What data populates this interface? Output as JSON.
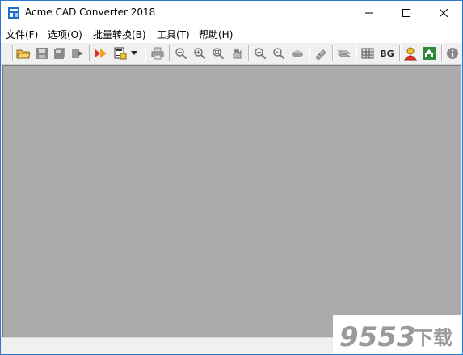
{
  "window": {
    "title": "Acme CAD Converter 2018",
    "controls": {
      "minimize": "minimize-icon",
      "maximize": "maximize-icon",
      "close": "close-icon"
    }
  },
  "menu": [
    {
      "label": "文件(F)"
    },
    {
      "label": "选项(O)"
    },
    {
      "label": "批量转换(B)"
    },
    {
      "label": "工具(T)"
    },
    {
      "label": "帮助(H)"
    }
  ],
  "toolbar": {
    "bg_label": "BG",
    "icons": [
      "open-folder-icon",
      "save-icon",
      "save-all-icon",
      "export-icon",
      "convert-icon",
      "batch-convert-icon",
      "dropdown-arrow-icon",
      "print-icon",
      "zoom-out-icon",
      "zoom-in-icon",
      "zoom-window-icon",
      "pan-icon",
      "zoom-extents-icon",
      "zoom-realtime-icon",
      "layers-icon",
      "measure-icon",
      "text-icon",
      "grid-icon",
      "background-icon",
      "user-icon",
      "home-icon",
      "info-icon"
    ]
  },
  "colors": {
    "workspace": "#ababab",
    "accent": "#2b79d0"
  },
  "watermark": {
    "text": "9553",
    "suffix": "下载",
    "color": "#9a9a9a"
  }
}
